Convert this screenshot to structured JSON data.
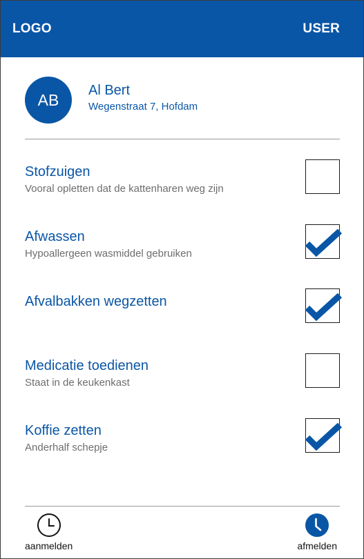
{
  "header": {
    "logo": "LOGO",
    "user": "USER"
  },
  "profile": {
    "initials": "AB",
    "name": "Al Bert",
    "address": "Wegenstraat 7, Hofdam"
  },
  "tasks": [
    {
      "title": "Stofzuigen",
      "subtitle": "Vooral opletten dat de kattenharen weg zijn",
      "checked": false
    },
    {
      "title": "Afwassen",
      "subtitle": "Hypoallergeen wasmiddel gebruiken",
      "checked": true
    },
    {
      "title": "Afvalbakken wegzetten",
      "subtitle": "",
      "checked": true
    },
    {
      "title": "Medicatie toedienen",
      "subtitle": "Staat in de keukenkast",
      "checked": false
    },
    {
      "title": "Koffie zetten",
      "subtitle": "Anderhalf schepje",
      "checked": true
    }
  ],
  "footer": {
    "clock_in_label": "aanmelden",
    "clock_out_label": "afmelden"
  },
  "colors": {
    "primary": "#0a56a6",
    "subtitle": "#6d6d6d"
  }
}
